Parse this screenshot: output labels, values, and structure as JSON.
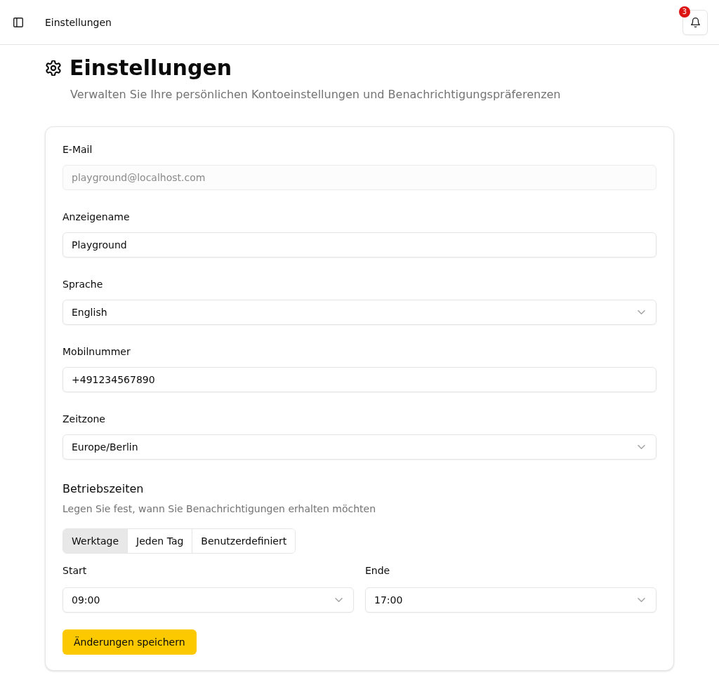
{
  "header": {
    "title": "Einstellungen",
    "notifications": {
      "count": "3"
    }
  },
  "page": {
    "title": "Einstellungen",
    "subtitle": "Verwalten Sie Ihre persönlichen Kontoeinstellungen und Benachrichtigungspräferenzen"
  },
  "form": {
    "fields": [
      {
        "kind": "input",
        "label": "E-Mail",
        "value": "playground@localhost.com",
        "disabled": true
      },
      {
        "kind": "input",
        "label": "Anzeigename",
        "value": "Playground",
        "disabled": false
      },
      {
        "kind": "select",
        "label": "Sprache",
        "value": "English",
        "disabled": false
      },
      {
        "kind": "input",
        "label": "Mobilnummer",
        "value": "+491234567890",
        "disabled": false
      },
      {
        "kind": "select",
        "label": "Zeitzone",
        "value": "Europe/Berlin",
        "disabled": false
      }
    ],
    "hours": {
      "title": "Betriebszeiten",
      "description": "Legen Sie fest, wann Sie Benachrichtigungen erhalten möchten",
      "modes": [
        {
          "label": "Werktage",
          "selected": true
        },
        {
          "label": "Jeden Tag",
          "selected": false
        },
        {
          "label": "Benutzerdefiniert",
          "selected": false
        }
      ],
      "range": [
        {
          "kind": "select",
          "label": "Start",
          "value": "09:00"
        },
        {
          "kind": "select",
          "label": "Ende",
          "value": "17:00"
        }
      ]
    },
    "save_button": "Änderungen speichern"
  }
}
